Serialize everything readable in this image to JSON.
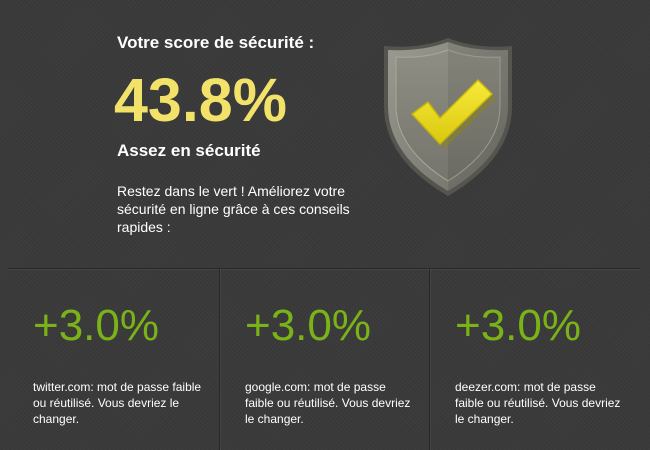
{
  "score": {
    "heading": "Votre score de sécurité :",
    "value": "43.8%",
    "level": "Assez en sécurité",
    "intro": "Restez dans le vert ! Améliorez votre sécurité en ligne grâce à ces conseils rapides :"
  },
  "shield": {
    "icon": "shield-check-icon",
    "shield_color": "#84847a",
    "check_color": "#f2e21b"
  },
  "tips": [
    {
      "gain": "+3.0%",
      "text": "twitter.com: mot de passe faible ou réutilisé. Vous devriez le changer."
    },
    {
      "gain": "+3.0%",
      "text": "google.com: mot de passe faible ou réutilisé. Vous devriez le changer."
    },
    {
      "gain": "+3.0%",
      "text": "deezer.com: mot de passe faible ou réutilisé. Vous devriez le changer."
    }
  ],
  "colors": {
    "background": "#3a3a3a",
    "score": "#f2e26a",
    "gain": "#7ab317",
    "text": "#ffffff"
  }
}
